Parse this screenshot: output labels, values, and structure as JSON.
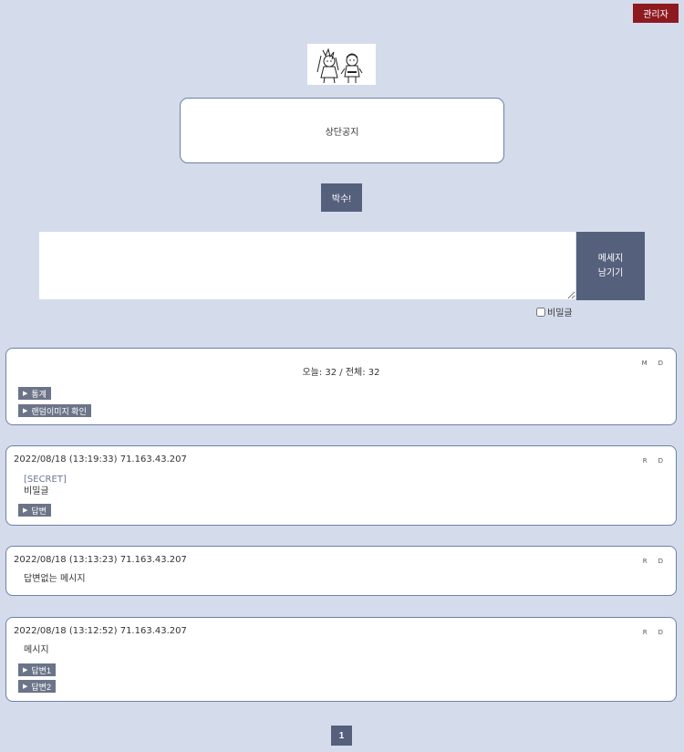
{
  "header": {
    "admin_label": "관리자"
  },
  "logo": {
    "icon": "character-illustration"
  },
  "notice": {
    "text": "상단공지"
  },
  "clap": {
    "label": "박수!"
  },
  "compose": {
    "textarea_value": "",
    "submit_line1": "메세지",
    "submit_line2": "남기기",
    "secret_label": "비밀글"
  },
  "stats": {
    "text": "오늘: 32 / 전체: 32",
    "action_m": "M",
    "action_d": "D",
    "btn_stats": "통계",
    "btn_random": "랜덤이미지 확인"
  },
  "messages": [
    {
      "date": "2022/08/18 (13:19:33) 71.163.43.207",
      "secret_tag": "[SECRET]",
      "text": "비밀글",
      "actions": {
        "r": "R",
        "d": "D"
      },
      "buttons": [
        "답변"
      ]
    },
    {
      "date": "2022/08/18 (13:13:23) 71.163.43.207",
      "text": "답변없는 메시지",
      "actions": {
        "r": "R",
        "d": "D"
      }
    },
    {
      "date": "2022/08/18 (13:12:52) 71.163.43.207",
      "text": "메시지",
      "actions": {
        "r": "R",
        "d": "D"
      },
      "buttons": [
        "답변1",
        "답변2"
      ]
    }
  ],
  "pagination": {
    "current": "1"
  }
}
